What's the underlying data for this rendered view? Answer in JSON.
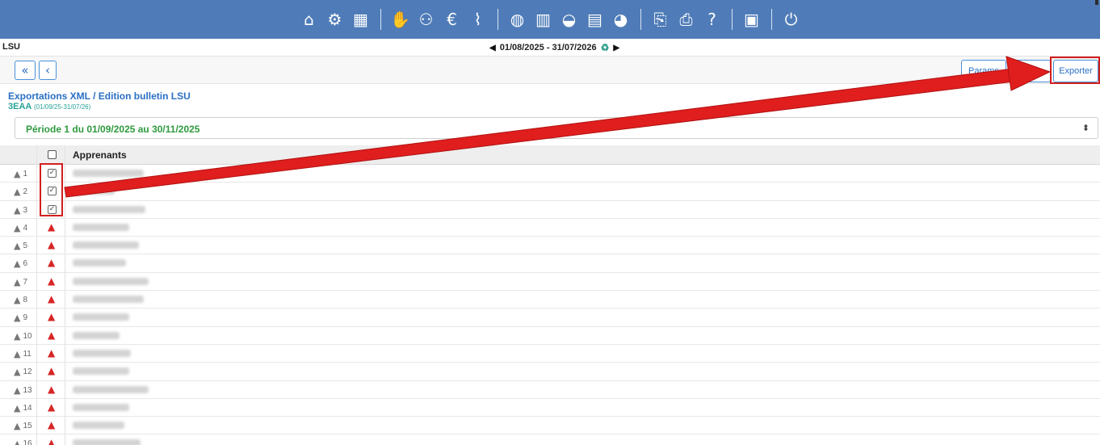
{
  "topbar": {
    "icons": [
      "home-icon",
      "settings-icon",
      "school-icon",
      "handshake-icon",
      "group-icon",
      "euro-icon",
      "chart-line-icon",
      "globe-icon",
      "calendar-icon",
      "car-icon",
      "id-card-icon",
      "user-clock-icon",
      "export-icon",
      "print-icon",
      "help-icon",
      "screen-icon",
      "power-icon"
    ],
    "color": "#4f7cb8"
  },
  "header": {
    "module": "LSU",
    "date_range": "01/08/2025  - 31/07/2026"
  },
  "toolbar": {
    "params_label": "Params",
    "blank_label": "",
    "export_label": "Exporter"
  },
  "page": {
    "title": "Exportations XML / Edition bulletin LSU",
    "class_name": "3EAA",
    "class_dates": "(01/09/25-31/07/26)"
  },
  "period": {
    "selected": "Période 1 du 01/09/2025 au 30/11/2025"
  },
  "table": {
    "column_label": "Apprenants",
    "rows": [
      {
        "num": "1",
        "checked": true,
        "name_width": 88
      },
      {
        "num": "2",
        "checked": true,
        "name_width": 52
      },
      {
        "num": "3",
        "checked": true,
        "name_width": 90
      },
      {
        "num": "4",
        "checked": false,
        "name_width": 70
      },
      {
        "num": "5",
        "checked": false,
        "name_width": 82
      },
      {
        "num": "6",
        "checked": false,
        "name_width": 66
      },
      {
        "num": "7",
        "checked": false,
        "name_width": 94
      },
      {
        "num": "8",
        "checked": false,
        "name_width": 88
      },
      {
        "num": "9",
        "checked": false,
        "name_width": 70
      },
      {
        "num": "10",
        "checked": false,
        "name_width": 58
      },
      {
        "num": "11",
        "checked": false,
        "name_width": 72
      },
      {
        "num": "12",
        "checked": false,
        "name_width": 70
      },
      {
        "num": "13",
        "checked": false,
        "name_width": 94
      },
      {
        "num": "14",
        "checked": false,
        "name_width": 70
      },
      {
        "num": "15",
        "checked": false,
        "name_width": 64
      },
      {
        "num": "16",
        "checked": false,
        "name_width": 84
      }
    ]
  },
  "colors": {
    "accent": "#2a6fc4",
    "highlight": "#d31e1e",
    "period_text": "#2e9a3e",
    "class_text": "#28a196"
  }
}
